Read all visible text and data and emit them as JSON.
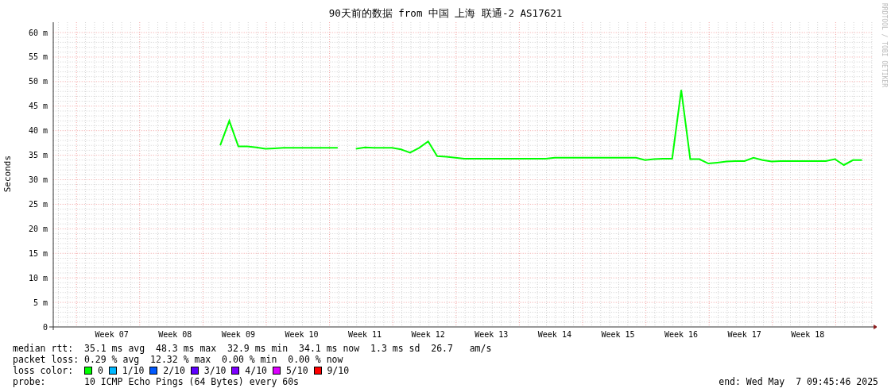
{
  "watermark": "RRDTOOL / TOBI OETIKER",
  "chart": {
    "chart_data": {
      "type": "line",
      "title": "90天前的数据 from 中国 上海 联通-2 AS17621",
      "ylabel": "Seconds",
      "categories": [
        null,
        null,
        null,
        null,
        null,
        null,
        "Week 07",
        null,
        null,
        null,
        null,
        null,
        null,
        "Week 08",
        null,
        null,
        null,
        null,
        null,
        null,
        "Week 09",
        null,
        null,
        null,
        null,
        null,
        null,
        "Week 10",
        null,
        null,
        null,
        null,
        null,
        null,
        "Week 11",
        null,
        null,
        null,
        null,
        null,
        null,
        "Week 12",
        null,
        null,
        null,
        null,
        null,
        null,
        "Week 13",
        null,
        null,
        null,
        null,
        null,
        null,
        "Week 14",
        null,
        null,
        null,
        null,
        null,
        null,
        "Week 15",
        null,
        null,
        null,
        null,
        null,
        null,
        "Week 16",
        null,
        null,
        null,
        null,
        null,
        null,
        "Week 17",
        null,
        null,
        null,
        null,
        null,
        null,
        "Week 18",
        null,
        null,
        null,
        null,
        null,
        null
      ],
      "series": [
        {
          "color": "#00ff00",
          "values": [
            null,
            null,
            null,
            null,
            null,
            null,
            null,
            null,
            null,
            null,
            null,
            null,
            null,
            null,
            null,
            null,
            null,
            null,
            37.0,
            42,
            36.8,
            36.8,
            36.6,
            36.3,
            36.4,
            36.5,
            36.5,
            36.5,
            36.5,
            36.5,
            36.5,
            36.5,
            null,
            36.3,
            36.6,
            36.5,
            36.5,
            36.5,
            36.2,
            35.5,
            36.5,
            37.8,
            34.8,
            34.7,
            34.5,
            34.3,
            34.3,
            34.3,
            34.3,
            34.3,
            34.3,
            34.3,
            34.3,
            34.3,
            34.3,
            34.5,
            34.5,
            34.5,
            34.5,
            34.5,
            34.5,
            34.5,
            34.5,
            34.5,
            34.5,
            34.0,
            34.2,
            34.3,
            34.3,
            48.3,
            34.2,
            34.2,
            33.3,
            33.5,
            33.7,
            33.8,
            33.8,
            34.5,
            34.0,
            33.7,
            33.8,
            33.8,
            33.8,
            33.8,
            33.8,
            33.8,
            34.2,
            33.0,
            34.0,
            34.0
          ]
        }
      ],
      "grid": true,
      "ylim": [
        0,
        60
      ],
      "yticks": [
        {
          "value": 0,
          "label": "0"
        },
        {
          "value": 5,
          "label": "5 m"
        },
        {
          "value": 10,
          "label": "10 m"
        },
        {
          "value": 15,
          "label": "15 m"
        },
        {
          "value": 20,
          "label": "20 m"
        },
        {
          "value": 25,
          "label": "25 m"
        },
        {
          "value": 30,
          "label": "30 m"
        },
        {
          "value": 35,
          "label": "35 m"
        },
        {
          "value": 40,
          "label": "40 m"
        },
        {
          "value": 45,
          "label": "45 m"
        },
        {
          "value": 50,
          "label": "50 m"
        },
        {
          "value": 55,
          "label": "55 m"
        },
        {
          "value": 60,
          "label": "60 m"
        }
      ]
    }
  },
  "legend": {
    "median_rtt": {
      "label": "median rtt:",
      "values": [
        "35.1 ms avg",
        "48.3 ms max",
        "32.9 ms min",
        "34.1 ms now",
        "1.3 ms sd",
        "26.7   am/s"
      ]
    },
    "packet_loss": {
      "label": "packet loss:",
      "values": [
        "0.29 % avg",
        "12.32 % max",
        "0.00 % min",
        "0.00 % now"
      ]
    },
    "loss_color": {
      "label": "loss color:",
      "items": [
        {
          "label": "0",
          "color": "#00ff00"
        },
        {
          "label": "1/10",
          "color": "#00b8ff"
        },
        {
          "label": "2/10",
          "color": "#0059ff"
        },
        {
          "label": "3/10",
          "color": "#5e00ff"
        },
        {
          "label": "4/10",
          "color": "#7e00ff"
        },
        {
          "label": "5/10",
          "color": "#dd00ff"
        },
        {
          "label": "9/10",
          "color": "#ff0000"
        }
      ]
    },
    "probe": {
      "label": "probe:",
      "value": "10 ICMP Echo Pings (64 Bytes) every 60s"
    },
    "end": "end: Wed May  7 09:45:46 2025"
  }
}
